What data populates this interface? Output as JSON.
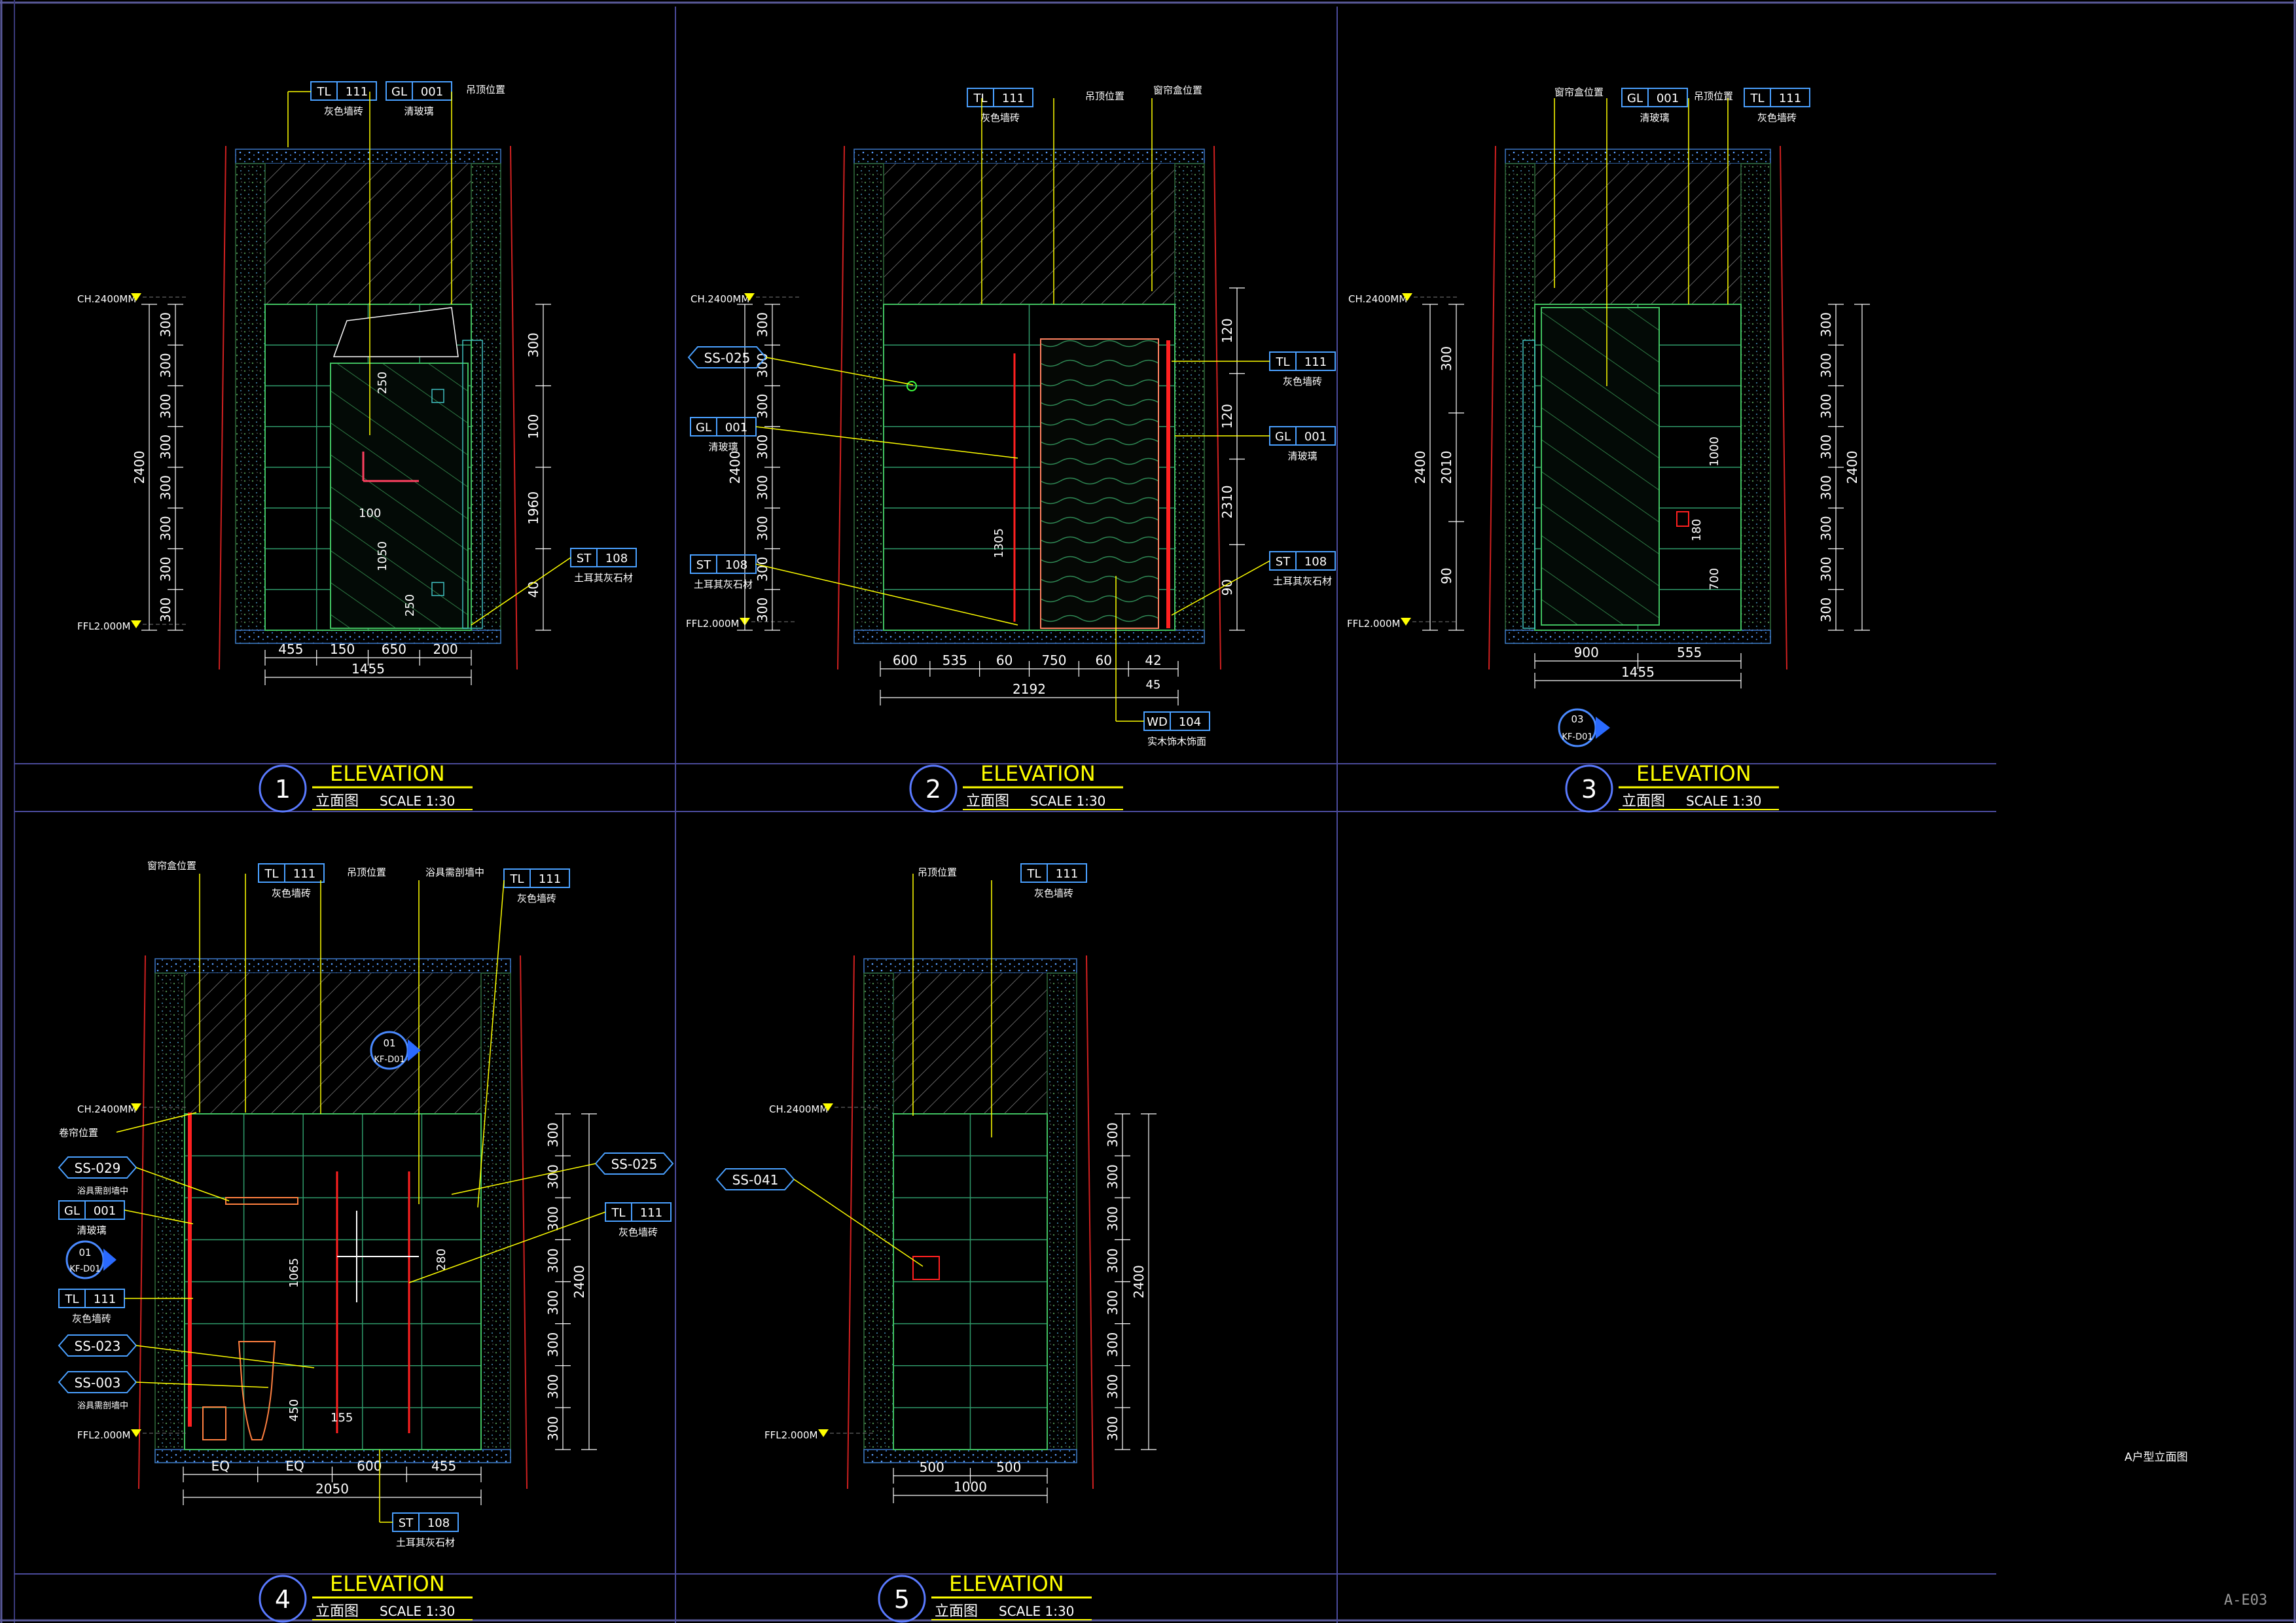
{
  "sheet": {
    "number": "A-E03",
    "title_note": "A户型立面图"
  },
  "common": {
    "ch_level": "CH.2400MM",
    "ffl_level": "FFL2.000M",
    "elevation_word": "ELEVATION",
    "subtitle_cn": "立面图",
    "scale": "SCALE  1:30"
  },
  "panels": [
    {
      "no": "1",
      "tags": [
        {
          "code": "TL",
          "num": "111",
          "desc": "灰色墙砖"
        },
        {
          "code": "GL",
          "num": "001",
          "desc": "清玻璃"
        },
        {
          "code": "ST",
          "num": "108",
          "desc": "土耳其灰石材"
        }
      ],
      "notes": [
        "吊顶位置"
      ],
      "dims_left": [
        "300",
        "300",
        "300",
        "300",
        "300",
        "300",
        "300",
        "300"
      ],
      "dim_left_total": "2400",
      "dims_right": [
        "300",
        "100",
        "1960",
        "40"
      ],
      "dims_bottom": [
        "455",
        "150",
        "650",
        "200"
      ],
      "dim_bottom_total": "1455",
      "inner_dims": [
        "250",
        "100",
        "1050",
        "250"
      ]
    },
    {
      "no": "2",
      "tags": [
        {
          "code": "TL",
          "num": "111",
          "desc": "灰色墙砖"
        },
        {
          "code": "GL",
          "num": "001",
          "desc": "清玻璃"
        },
        {
          "code": "GL",
          "num": "001",
          "desc": "清玻璃"
        },
        {
          "code": "ST",
          "num": "108",
          "desc": "土耳其灰石材"
        },
        {
          "code": "ST",
          "num": "108",
          "desc": "土耳其灰石材"
        },
        {
          "code": "WD",
          "num": "104",
          "desc": "实木饰木饰面"
        }
      ],
      "callouts": [
        "SS-025"
      ],
      "notes": [
        "吊顶位置",
        "窗帘盒位置"
      ],
      "dims_left": [
        "300",
        "300",
        "300",
        "300",
        "300",
        "300",
        "300",
        "300"
      ],
      "dim_left_total": "2400",
      "dims_right": [
        "120",
        "120",
        "2310",
        "90"
      ],
      "dims_bottom": [
        "600",
        "535",
        "60",
        "750",
        "60",
        "42"
      ],
      "dim_bottom_sub": "45",
      "dim_bottom_total": "2192",
      "inner_dims": [
        "1305"
      ]
    },
    {
      "no": "3",
      "tags": [
        {
          "code": "GL",
          "num": "001",
          "desc": "清玻璃"
        },
        {
          "code": "TL",
          "num": "111",
          "desc": "灰色墙砖"
        }
      ],
      "notes": [
        "窗帘盒位置",
        "吊顶位置"
      ],
      "dims_left": [
        "300",
        "2010",
        "90"
      ],
      "dim_left_total": "2400",
      "dims_right": [
        "300",
        "300",
        "300",
        "300",
        "300",
        "300",
        "300",
        "300"
      ],
      "dim_right_total": "2400",
      "dims_bottom": [
        "900",
        "555"
      ],
      "dim_bottom_total": "1455",
      "inner_dims": [
        "1000",
        "180",
        "700"
      ],
      "section_marker": {
        "top": "03",
        "bottom": "KF-D01"
      }
    },
    {
      "no": "4",
      "tags": [
        {
          "code": "TL",
          "num": "111",
          "desc": "灰色墙砖"
        },
        {
          "code": "TL",
          "num": "111",
          "desc": "灰色墙砖"
        },
        {
          "code": "TL",
          "num": "111",
          "desc": "灰色墙砖"
        },
        {
          "code": "TL",
          "num": "111",
          "desc": "灰色墙砖"
        },
        {
          "code": "GL",
          "num": "001",
          "desc": "清玻璃"
        },
        {
          "code": "ST",
          "num": "108",
          "desc": "土耳其灰石材"
        }
      ],
      "callouts": [
        "SS-029",
        "SS-023",
        "SS-003",
        "SS-025"
      ],
      "callout_notes": [
        "浴具需剖墙中",
        "浴具需剖墙中"
      ],
      "notes": [
        "窗帘盒位置",
        "吊顶位置",
        "浴具需剖墙中",
        "卷帘位置"
      ],
      "dims_right": [
        "300",
        "300",
        "300",
        "300",
        "300",
        "300",
        "300",
        "300"
      ],
      "dim_right_total": "2400",
      "dims_bottom": [
        "EQ",
        "EQ",
        "600",
        "455"
      ],
      "dim_bottom_total": "2050",
      "inner_dims": [
        "1065",
        "280",
        "450",
        "155"
      ],
      "section_markers": [
        {
          "top": "01",
          "bottom": "KF-D01"
        },
        {
          "top": "01",
          "bottom": "KF-D01"
        }
      ]
    },
    {
      "no": "5",
      "tags": [
        {
          "code": "TL",
          "num": "111",
          "desc": "灰色墙砖"
        }
      ],
      "callouts": [
        "SS-041"
      ],
      "notes": [
        "吊顶位置"
      ],
      "dims_right": [
        "300",
        "300",
        "300",
        "300",
        "300",
        "300",
        "300",
        "300"
      ],
      "dim_right_total": "2400",
      "dims_bottom": [
        "500",
        "500"
      ],
      "dim_bottom_total": "1000"
    }
  ]
}
